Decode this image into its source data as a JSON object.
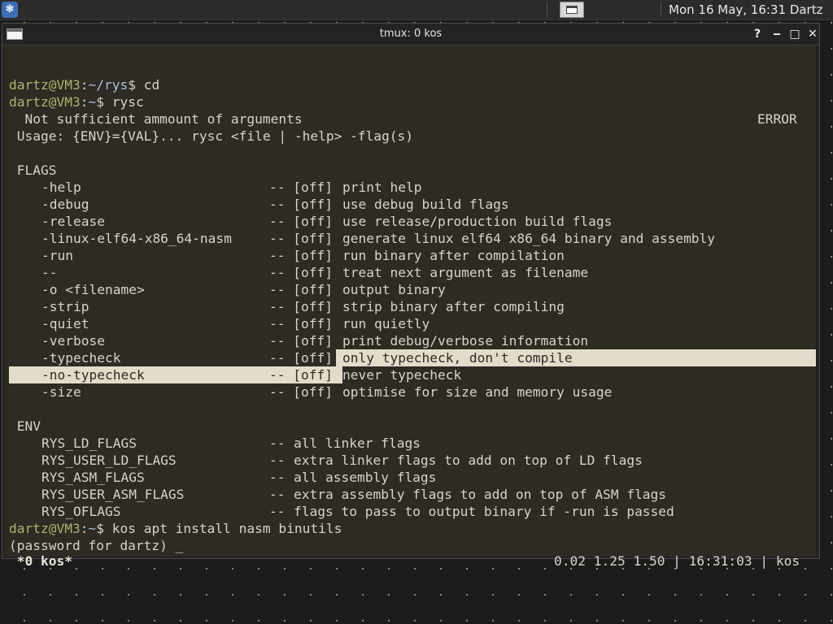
{
  "top_panel": {
    "menu_icon": "distro-logo-icon",
    "clock": "Mon 16 May, 16:31",
    "user": "Dartz"
  },
  "window": {
    "title": "tmux: 0 kos",
    "buttons": {
      "help": "?",
      "minimize": "‒",
      "maximize": "□",
      "close": "✕"
    }
  },
  "terminal": {
    "prompt1": {
      "user_host": "dartz@VM3",
      "sep": ":",
      "path": "~/rys",
      "sigil": "$",
      "cmd": " cd"
    },
    "prompt2": {
      "user_host": "dartz@VM3",
      "sep": ":",
      "path": "~",
      "sigil": "$",
      "cmd": " rysc"
    },
    "error_line": "  Not sufficient ammount of arguments",
    "error_tag": "ERROR",
    "usage": " Usage: {ENV}={VAL}... rysc <file | -help> -flag(s)",
    "flags_header": " FLAGS",
    "flags": [
      {
        "name": "-help",
        "state": "[off]",
        "desc": "print help"
      },
      {
        "name": "-debug",
        "state": "[off]",
        "desc": "use debug build flags"
      },
      {
        "name": "-release",
        "state": "[off]",
        "desc": "use release/production build flags"
      },
      {
        "name": "-linux-elf64-x86_64-nasm",
        "state": "[off]",
        "desc": "generate linux elf64 x86_64 binary and assembly"
      },
      {
        "name": "-run",
        "state": "[off]",
        "desc": "run binary after compilation"
      },
      {
        "name": "--",
        "state": "[off]",
        "desc": "treat next argument as filename"
      },
      {
        "name": "-o <filename>",
        "state": "[off]",
        "desc": "output binary"
      },
      {
        "name": "-strip",
        "state": "[off]",
        "desc": "strip binary after compiling"
      },
      {
        "name": "-quiet",
        "state": "[off]",
        "desc": "run quietly"
      },
      {
        "name": "-verbose",
        "state": "[off]",
        "desc": "print debug/verbose information"
      },
      {
        "name": "-typecheck",
        "state": "[off]",
        "desc": "only typecheck, don't compile"
      },
      {
        "name": "-no-typecheck",
        "state": "[off]",
        "desc": "never typecheck"
      },
      {
        "name": "-size",
        "state": "[off]",
        "desc": "optimise for size and memory usage"
      }
    ],
    "env_header": " ENV",
    "env": [
      {
        "name": "RYS_LD_FLAGS",
        "desc": "all linker flags"
      },
      {
        "name": "RYS_USER_LD_FLAGS",
        "desc": "extra linker flags to add on top of LD flags"
      },
      {
        "name": "RYS_ASM_FLAGS",
        "desc": "all assembly flags"
      },
      {
        "name": "RYS_USER_ASM_FLAGS",
        "desc": "extra assembly flags to add on top of ASM flags"
      },
      {
        "name": "RYS_OFLAGS",
        "desc": "flags to pass to output binary if -run is passed"
      }
    ],
    "prompt3": {
      "user_host": "dartz@VM3",
      "sep": ":",
      "path": "~",
      "sigil": "$",
      "cmd": " kos apt install nasm binutils"
    },
    "password_prompt": "(password for dartz) _",
    "status_left": " *0 kos*",
    "status_right": "0.02 1.25 1.50 | 16:31:03 | kos"
  }
}
